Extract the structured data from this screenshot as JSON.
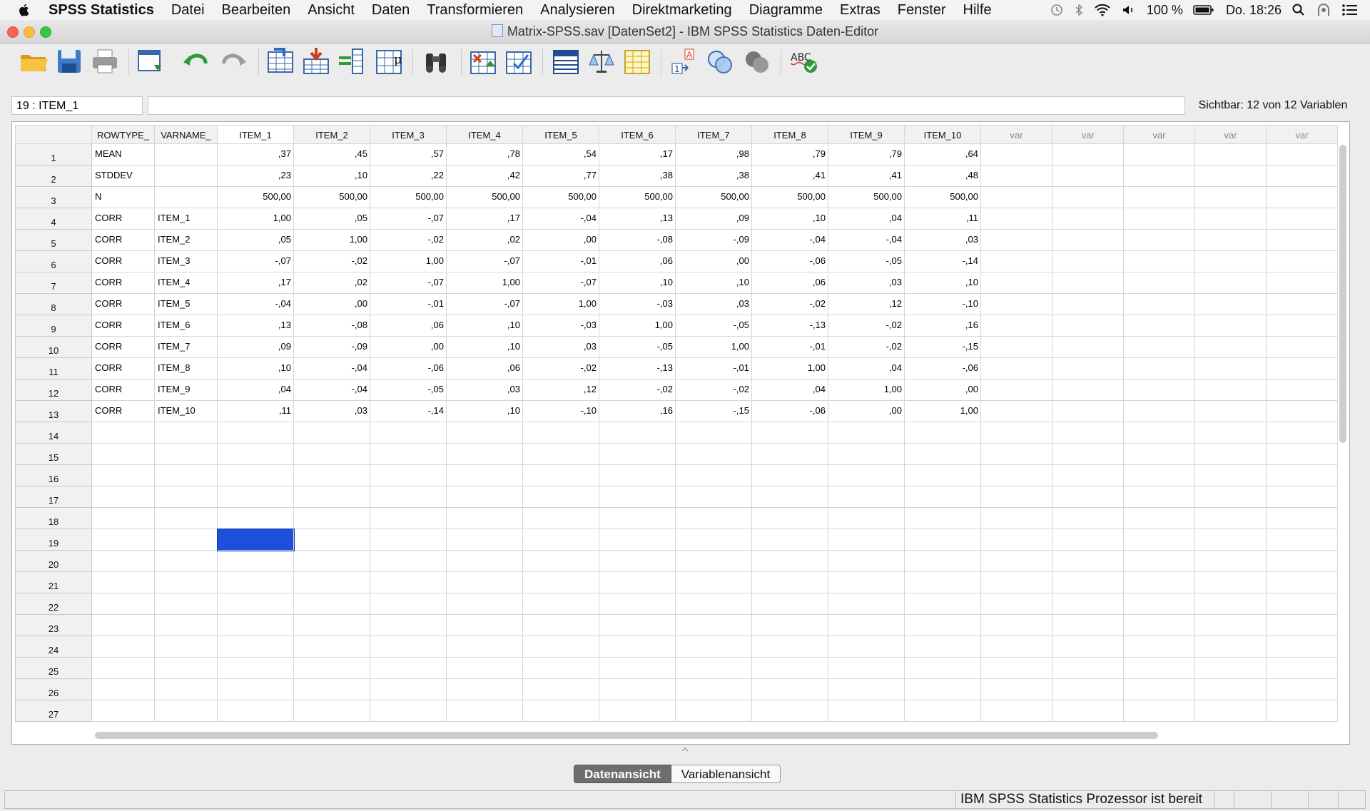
{
  "menubar": {
    "app_name": "SPSS Statistics",
    "items": [
      "Datei",
      "Bearbeiten",
      "Ansicht",
      "Daten",
      "Transformieren",
      "Analysieren",
      "Direktmarketing",
      "Diagramme",
      "Extras",
      "Fenster",
      "Hilfe"
    ],
    "battery": "100 %",
    "clock": "Do. 18:26"
  },
  "window": {
    "title": "Matrix-SPSS.sav [DatenSet2] - IBM SPSS Statistics Daten-Editor"
  },
  "toolbar": {
    "icons": [
      "open-icon",
      "save-icon",
      "print-icon",
      "recall-dialog-icon",
      "undo-icon",
      "redo-icon",
      "goto-case-icon",
      "goto-variable-icon",
      "variables-icon",
      "run-descriptives-icon",
      "find-icon",
      "insert-cases-icon",
      "insert-variable-icon",
      "split-file-icon",
      "weight-cases-icon",
      "select-cases-icon",
      "value-labels-icon",
      "use-variable-sets-icon",
      "show-all-variables-icon",
      "spell-check-icon"
    ]
  },
  "infobar": {
    "cell_ref": "19 : ITEM_1",
    "cell_value": "",
    "visible_vars": "Sichtbar: 12 von 12 Variablen"
  },
  "grid": {
    "columns": [
      "ROWTYPE_",
      "VARNAME_",
      "ITEM_1",
      "ITEM_2",
      "ITEM_3",
      "ITEM_4",
      "ITEM_5",
      "ITEM_6",
      "ITEM_7",
      "ITEM_8",
      "ITEM_9",
      "ITEM_10",
      "var",
      "var",
      "var",
      "var",
      "var"
    ],
    "rows": [
      [
        "MEAN",
        "",
        ",37",
        ",45",
        ",57",
        ",78",
        ",54",
        ",17",
        ",98",
        ",79",
        ",79",
        ",64"
      ],
      [
        "STDDEV",
        "",
        ",23",
        ",10",
        ",22",
        ",42",
        ",77",
        ",38",
        ",38",
        ",41",
        ",41",
        ",48"
      ],
      [
        "N",
        "",
        "500,00",
        "500,00",
        "500,00",
        "500,00",
        "500,00",
        "500,00",
        "500,00",
        "500,00",
        "500,00",
        "500,00"
      ],
      [
        "CORR",
        "ITEM_1",
        "1,00",
        ",05",
        "-,07",
        ",17",
        "-,04",
        ",13",
        ",09",
        ",10",
        ",04",
        ",11"
      ],
      [
        "CORR",
        "ITEM_2",
        ",05",
        "1,00",
        "-,02",
        ",02",
        ",00",
        "-,08",
        "-,09",
        "-,04",
        "-,04",
        ",03"
      ],
      [
        "CORR",
        "ITEM_3",
        "-,07",
        "-,02",
        "1,00",
        "-,07",
        "-,01",
        ",06",
        ",00",
        "-,06",
        "-,05",
        "-,14"
      ],
      [
        "CORR",
        "ITEM_4",
        ",17",
        ",02",
        "-,07",
        "1,00",
        "-,07",
        ",10",
        ",10",
        ",06",
        ",03",
        ",10"
      ],
      [
        "CORR",
        "ITEM_5",
        "-,04",
        ",00",
        "-,01",
        "-,07",
        "1,00",
        "-,03",
        ",03",
        "-,02",
        ",12",
        "-,10"
      ],
      [
        "CORR",
        "ITEM_6",
        ",13",
        "-,08",
        ",06",
        ",10",
        "-,03",
        "1,00",
        "-,05",
        "-,13",
        "-,02",
        ",16"
      ],
      [
        "CORR",
        "ITEM_7",
        ",09",
        "-,09",
        ",00",
        ",10",
        ",03",
        "-,05",
        "1,00",
        "-,01",
        "-,02",
        "-,15"
      ],
      [
        "CORR",
        "ITEM_8",
        ",10",
        "-,04",
        "-,06",
        ",06",
        "-,02",
        "-,13",
        "-,01",
        "1,00",
        ",04",
        "-,06"
      ],
      [
        "CORR",
        "ITEM_9",
        ",04",
        "-,04",
        "-,05",
        ",03",
        ",12",
        "-,02",
        "-,02",
        ",04",
        "1,00",
        ",00"
      ],
      [
        "CORR",
        "ITEM_10",
        ",11",
        ",03",
        "-,14",
        ",10",
        "-,10",
        ",16",
        "-,15",
        "-,06",
        ",00",
        "1,00"
      ]
    ],
    "row_numbers": [
      "1",
      "2",
      "3",
      "4",
      "5",
      "6",
      "7",
      "8",
      "9",
      "10",
      "11",
      "12",
      "13",
      "14",
      "15",
      "16",
      "17",
      "18",
      "19",
      "20",
      "21",
      "22",
      "23",
      "24",
      "25",
      "26",
      "27"
    ],
    "selected_row": 19,
    "selected_column": "ITEM_1",
    "selection_color": "#1d4fd8"
  },
  "tabs": {
    "data_view": "Datenansicht",
    "variable_view": "Variablenansicht",
    "active": "Datenansicht"
  },
  "status": {
    "message": "IBM SPSS Statistics  Prozessor ist bereit"
  }
}
